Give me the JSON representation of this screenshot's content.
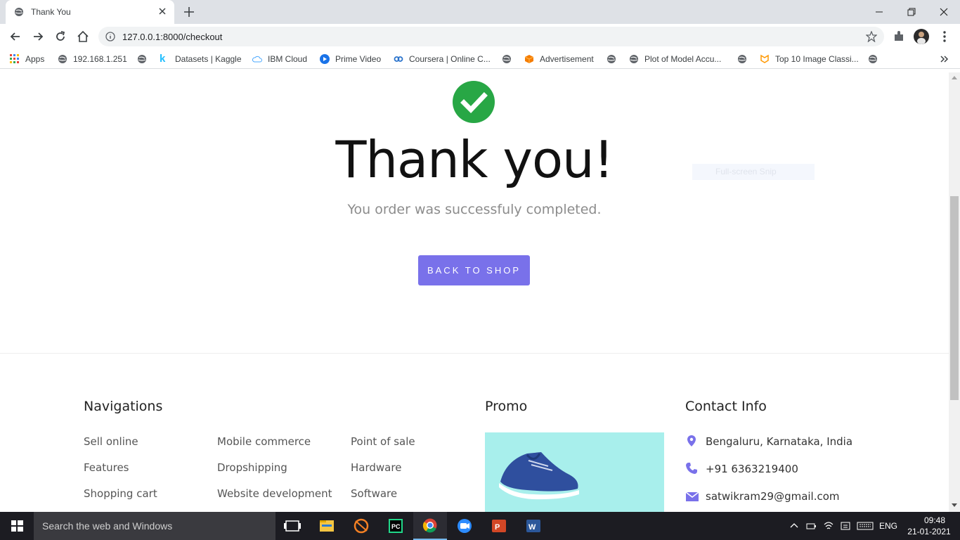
{
  "browser": {
    "tab_title": "Thank You",
    "url": "127.0.0.1:8000/checkout",
    "bookmarks": [
      {
        "label": "Apps",
        "icon": "apps-grid-icon"
      },
      {
        "label": "192.168.1.251",
        "icon": "globe-icon"
      },
      {
        "label": "Datasets | Kaggle",
        "icon": "kaggle-icon"
      },
      {
        "label": "IBM Cloud",
        "icon": "cloud-icon"
      },
      {
        "label": "Prime Video",
        "icon": "play-icon"
      },
      {
        "label": "Coursera | Online C...",
        "icon": "coursera-icon"
      },
      {
        "label": "Advertisement",
        "icon": "cube-icon"
      },
      {
        "label": "Plot of Model Accu...",
        "icon": "globe-icon"
      },
      {
        "label": "Top 10 Image Classi...",
        "icon": "tf-icon"
      }
    ]
  },
  "page": {
    "title": "Thank you!",
    "subtitle": "You order was successfuly completed.",
    "back_button": "BACK TO SHOP",
    "snip_ghost": "Full-screen Snip",
    "accent_color": "#7971ea",
    "success_color": "#28a745"
  },
  "footer": {
    "nav_heading": "Navigations",
    "nav_col1": [
      "Sell online",
      "Features",
      "Shopping cart"
    ],
    "nav_col2": [
      "Mobile commerce",
      "Dropshipping",
      "Website development"
    ],
    "nav_col3": [
      "Point of sale",
      "Hardware",
      "Software"
    ],
    "promo_heading": "Promo",
    "contact_heading": "Contact Info",
    "contact": {
      "address": "Bengaluru, Karnataka, India",
      "phone": "+91 6363219400",
      "email": "satwikram29@gmail.com"
    }
  },
  "taskbar": {
    "search_placeholder": "Search the web and Windows",
    "language": "ENG",
    "time": "09:48",
    "date": "21-01-2021"
  }
}
